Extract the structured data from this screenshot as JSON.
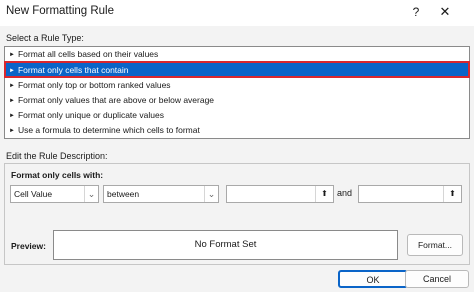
{
  "window": {
    "title": "New Formatting Rule",
    "help": "?",
    "close": "✕"
  },
  "rule_type": {
    "label": "Select a Rule Type:",
    "items": [
      "Format all cells based on their values",
      "Format only cells that contain",
      "Format only top or bottom ranked values",
      "Format only values that are above or below average",
      "Format only unique or duplicate values",
      "Use a formula to determine which cells to format"
    ],
    "selected_index": 1,
    "arrow": "►"
  },
  "description": {
    "label": "Edit the Rule Description:",
    "heading": "Format only cells with:",
    "condition_select": "Cell Value",
    "operator_select": "between",
    "value1": "",
    "value2": "",
    "and_label": "and",
    "picker_icon": "⬆",
    "chevron": "⌄",
    "preview_label": "Preview:",
    "preview_text": "No Format Set",
    "format_button": "Format..."
  },
  "buttons": {
    "ok": "OK",
    "cancel": "Cancel"
  },
  "colors": {
    "selection": "#0a64c8",
    "highlight_border": "#d9272e"
  }
}
